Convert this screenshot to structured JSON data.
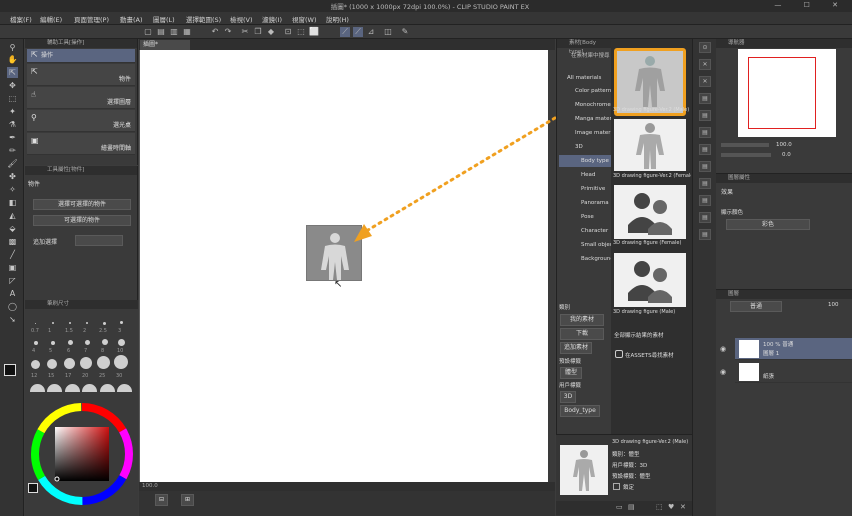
{
  "window": {
    "title": "插圖* (1000 x 1000px 72dpi 100.0%)  - CLIP STUDIO PAINT EX",
    "controls": "— ☐ ✕"
  },
  "menu": [
    "檔案(F)",
    "編輯(E)",
    "頁面管理(P)",
    "動畫(A)",
    "圖層(L)",
    "選擇範圍(S)",
    "檢視(V)",
    "濾鏡(I)",
    "視窗(W)",
    "說明(H)"
  ],
  "subtool_panel": {
    "header": "輔助工具[操作]",
    "items": [
      {
        "label": "操作",
        "selected": true
      },
      {
        "label": "物件",
        "selected": false
      },
      {
        "label": "選擇圖層",
        "selected": false
      },
      {
        "label": "選光桌",
        "selected": false
      },
      {
        "label": "繪畫時間軸",
        "selected": false
      }
    ]
  },
  "tool_property": {
    "header": "工具屬性[物件]",
    "title": "物件",
    "dropdown1": "選擇可選擇的物件",
    "dropdown2": "可選擇的物件",
    "row_label": "追加選擇"
  },
  "brush_panel": {
    "header": "筆刷尺寸",
    "sizes_row1": [
      "0.7",
      "1",
      "1.5",
      "2",
      "2.5",
      "3"
    ],
    "sizes_row2": [
      "4",
      "5",
      "6",
      "7",
      "8",
      "10"
    ],
    "sizes_row3": [
      "12",
      "15",
      "17",
      "20",
      "25",
      "30"
    ]
  },
  "canvas": {
    "tab_label": "插圖*",
    "status": "100.0"
  },
  "material_panel": {
    "header": "素材[Body type]",
    "search_hint": "在素材庫中搜尋",
    "tree": [
      {
        "label": "All materials",
        "selected": false
      },
      {
        "label": "Color pattern",
        "selected": false
      },
      {
        "label": "Monochrome",
        "selected": false
      },
      {
        "label": "Manga material",
        "selected": false
      },
      {
        "label": "Image material",
        "selected": false
      },
      {
        "label": "3D",
        "selected": false
      },
      {
        "label": "Body type",
        "selected": true
      },
      {
        "label": "Head",
        "selected": false
      },
      {
        "label": "Primitive",
        "selected": false
      },
      {
        "label": "Panorama",
        "selected": false
      },
      {
        "label": "Pose",
        "selected": false
      },
      {
        "label": "Character",
        "selected": false
      },
      {
        "label": "Small object",
        "selected": false
      },
      {
        "label": "Background",
        "selected": false
      }
    ],
    "filter_header": "類別",
    "filter_buttons": [
      "我的素材",
      "下載",
      "追加素材"
    ],
    "tag_header1": "預設標籤",
    "tag1": "體型",
    "tag_header2": "用戶標籤",
    "tag2": "3D",
    "tag3": "Body_type",
    "thumbs": [
      {
        "caption": "3D drawing figure-Ver.2 (Male)",
        "highlighted": true
      },
      {
        "caption": "3D drawing figure-Ver.2 (Female)",
        "highlighted": false
      },
      {
        "caption": "3D drawing figure (Female)",
        "highlighted": false
      },
      {
        "caption": "3D drawing figure (Male)",
        "highlighted": false
      }
    ],
    "show_all": "全部顯示結果的素材",
    "assets_link": "在ASSETS尋找素材",
    "detail": {
      "name": "3D drawing figure-Ver.2 (Male)",
      "line1": "類別：體型",
      "line2": "用戶標籤：3D",
      "line3": "預設標籤：體型",
      "checkbox": "鎖定"
    }
  },
  "navigator": {
    "header": "導航器",
    "zoom": "100.0",
    "angle": "0.0"
  },
  "layer_property": {
    "header": "圖層屬性",
    "effect": "效果",
    "color_label": "顯示顏色",
    "color_value": "彩色"
  },
  "layers": {
    "header": "圖層",
    "blend": "普通",
    "opacity": "100",
    "items": [
      {
        "name": "100 % 普通",
        "sub": "圖層 1",
        "selected": true
      },
      {
        "name": "",
        "sub": "紙張",
        "selected": false
      }
    ]
  },
  "colors": {
    "accent": "#f0a020",
    "selection": "#5a6580",
    "panel": "#3a3a3a"
  }
}
